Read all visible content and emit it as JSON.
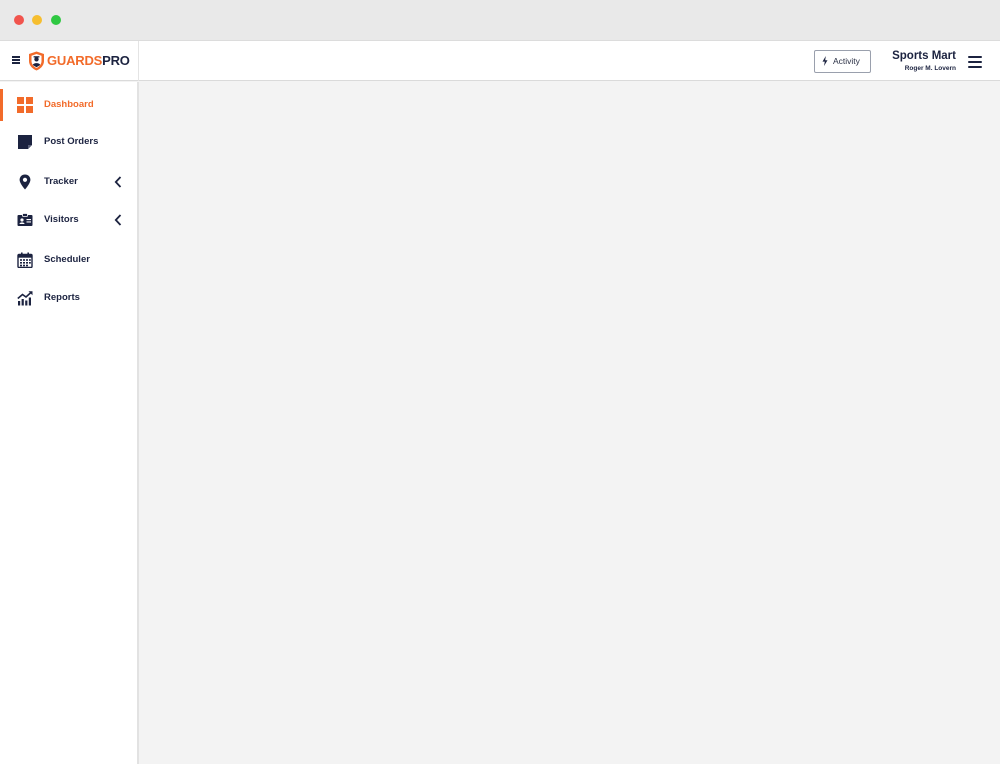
{
  "brand": {
    "name_part1": "GUARDS",
    "name_part2": "PRO",
    "accent_color": "#f26b2a",
    "dark_color": "#1c2340"
  },
  "topbar": {
    "activity_label": "Activity",
    "company_name": "Sports Mart",
    "user_name": "Roger M. Lovern"
  },
  "sidebar": {
    "items": [
      {
        "label": "Dashboard",
        "icon": "grid-icon",
        "active": true
      },
      {
        "label": "Post Orders",
        "icon": "note-icon"
      },
      {
        "label": "Tracker",
        "icon": "map-pin-icon",
        "expandable": true
      },
      {
        "label": "Visitors",
        "icon": "id-card-icon",
        "expandable": true
      },
      {
        "label": "Scheduler",
        "icon": "calendar-icon"
      },
      {
        "label": "Reports",
        "icon": "chart-up-icon"
      }
    ]
  }
}
